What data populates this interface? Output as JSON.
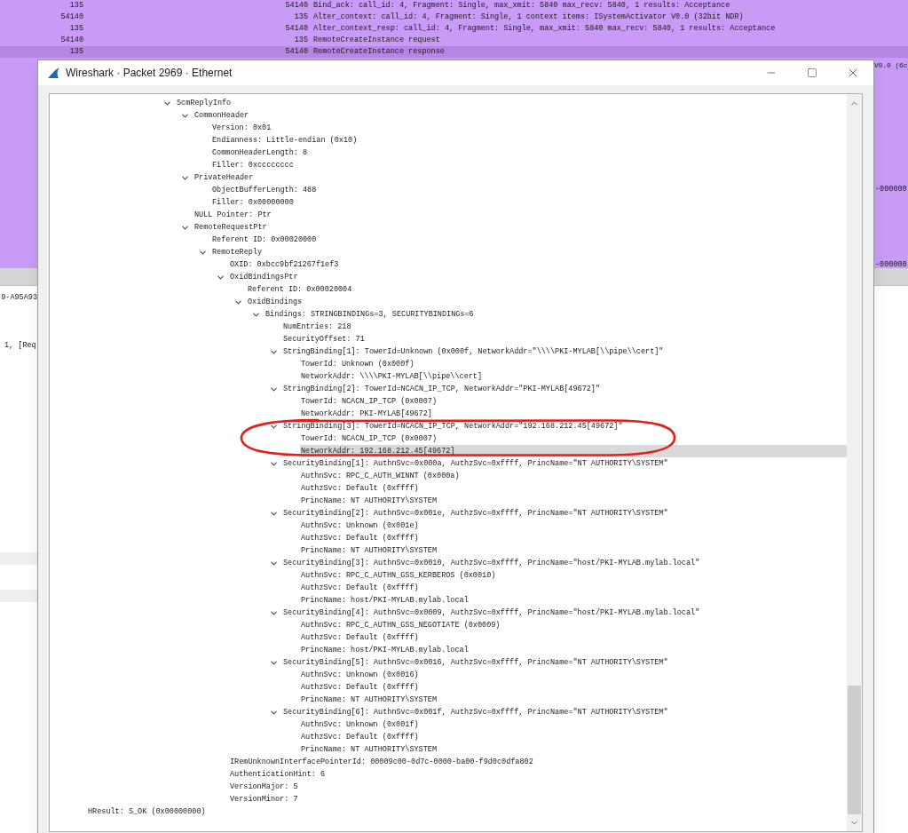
{
  "packet_list": {
    "rows": [
      {
        "source": "135",
        "destination": "54140",
        "info": "Bind_ack: call_id: 4, Fragment: Single, max_xmit: 5840 max_recv: 5840, 1 results: Acceptance",
        "selected": false
      },
      {
        "source": "54140",
        "destination": "135",
        "info": "Alter_context: call_id: 4, Fragment: Single, 1 context items: ISystemActivator V0.0 (32bit NDR)",
        "selected": false
      },
      {
        "source": "135",
        "destination": "54140",
        "info": "Alter_context_resp: call_id: 4, Fragment: Single, max_xmit: 5840 max_recv: 5840, 1 results: Acceptance",
        "selected": false
      },
      {
        "source": "54140",
        "destination": "135",
        "info": "RemoteCreateInstance request",
        "selected": false
      },
      {
        "source": "135",
        "destination": "54140",
        "info": "RemoteCreateInstance response",
        "selected": true
      }
    ],
    "partial_text": [
      "V0.0 (6c",
      "-000000",
      "-000000"
    ]
  },
  "packet_details": {
    "partial_text": [
      "9-A95A93",
      "1, [Req"
    ]
  },
  "dialog": {
    "title": "Wireshark · Packet 2969 · Ethernet",
    "tree": [
      {
        "label": "ScmReplyInfo",
        "expanded": true,
        "selected": false,
        "children": [
          {
            "label": "CommonHeader",
            "expanded": true,
            "selected": false,
            "children": [
              {
                "label": "Version: 0x01",
                "selected": false
              },
              {
                "label": "Endianness: Little-endian (0x10)",
                "selected": false
              },
              {
                "label": "CommonHeaderLength: 8",
                "selected": false
              },
              {
                "label": "Filler: 0xcccccccc",
                "selected": false
              }
            ]
          },
          {
            "label": "PrivateHeader",
            "expanded": true,
            "selected": false,
            "children": [
              {
                "label": "ObjectBufferLength: 488",
                "selected": false
              },
              {
                "label": "Filler: 0x00000000",
                "selected": false
              }
            ]
          },
          {
            "label": "NULL Pointer: Ptr",
            "selected": false
          },
          {
            "label": "RemoteRequestPtr",
            "expanded": true,
            "selected": false,
            "children": [
              {
                "label": "Referent ID: 0x00020000",
                "selected": false
              },
              {
                "label": "RemoteReply",
                "expanded": true,
                "selected": false,
                "children": [
                  {
                    "label": "OXID: 0xbcc9bf21267f1ef3",
                    "selected": false
                  },
                  {
                    "label": "OxidBindingsPtr",
                    "expanded": true,
                    "selected": false,
                    "children": [
                      {
                        "label": "Referent ID: 0x00020004",
                        "selected": false
                      },
                      {
                        "label": "OxidBindings",
                        "expanded": true,
                        "selected": false,
                        "children": [
                          {
                            "label": "Bindings: STRINGBINDINGs=3, SECURITYBINDINGs=6",
                            "expanded": true,
                            "selected": false,
                            "children": [
                              {
                                "label": "NumEntries: 218",
                                "selected": false
                              },
                              {
                                "label": "SecurityOffset: 71",
                                "selected": false
                              },
                              {
                                "label": "StringBinding[1]: TowerId=Unknown (0x000f, NetworkAddr=\"\\\\\\\\PKI-MYLAB[\\\\pipe\\\\cert]\"",
                                "expanded": true,
                                "selected": false,
                                "children": [
                                  {
                                    "label": "TowerId: Unknown (0x000f)",
                                    "selected": false
                                  },
                                  {
                                    "label": "NetworkAddr: \\\\\\\\PKI-MYLAB[\\\\pipe\\\\cert]",
                                    "selected": false
                                  }
                                ]
                              },
                              {
                                "label": "StringBinding[2]: TowerId=NCACN_IP_TCP, NetworkAddr=\"PKI-MYLAB[49672]\"",
                                "expanded": true,
                                "selected": false,
                                "children": [
                                  {
                                    "label": "TowerId: NCACN_IP_TCP (0x0007)",
                                    "selected": false
                                  },
                                  {
                                    "label": "NetworkAddr: PKI-MYLAB[49672]",
                                    "selected": false
                                  }
                                ]
                              },
                              {
                                "label": "StringBinding[3]: TowerId=NCACN_IP_TCP, NetworkAddr=\"192.168.212.45[49672]\"",
                                "expanded": true,
                                "selected": false,
                                "children": [
                                  {
                                    "label": "TowerId: NCACN_IP_TCP (0x0007)",
                                    "selected": false
                                  },
                                  {
                                    "label": "NetworkAddr: 192.168.212.45[49672]",
                                    "selected": true
                                  }
                                ]
                              },
                              {
                                "label": "SecurityBinding[1]: AuthnSvc=0x000a, AuthzSvc=0xffff, PrincName=\"NT AUTHORITY\\SYSTEM\"",
                                "expanded": true,
                                "selected": false,
                                "children": [
                                  {
                                    "label": "AuthnSvc: RPC_C_AUTH_WINNT (0x000a)",
                                    "selected": false
                                  },
                                  {
                                    "label": "AuthzSvc: Default (0xffff)",
                                    "selected": false
                                  },
                                  {
                                    "label": "PrincName: NT AUTHORITY\\SYSTEM",
                                    "selected": false
                                  }
                                ]
                              },
                              {
                                "label": "SecurityBinding[2]: AuthnSvc=0x001e, AuthzSvc=0xffff, PrincName=\"NT AUTHORITY\\SYSTEM\"",
                                "expanded": true,
                                "selected": false,
                                "children": [
                                  {
                                    "label": "AuthnSvc: Unknown (0x001e)",
                                    "selected": false
                                  },
                                  {
                                    "label": "AuthzSvc: Default (0xffff)",
                                    "selected": false
                                  },
                                  {
                                    "label": "PrincName: NT AUTHORITY\\SYSTEM",
                                    "selected": false
                                  }
                                ]
                              },
                              {
                                "label": "SecurityBinding[3]: AuthnSvc=0x0010, AuthzSvc=0xffff, PrincName=\"host/PKI-MYLAB.mylab.local\"",
                                "expanded": true,
                                "selected": false,
                                "children": [
                                  {
                                    "label": "AuthnSvc: RPC_C_AUTHN_GSS_KERBEROS (0x0010)",
                                    "selected": false
                                  },
                                  {
                                    "label": "AuthzSvc: Default (0xffff)",
                                    "selected": false
                                  },
                                  {
                                    "label": "PrincName: host/PKI-MYLAB.mylab.local",
                                    "selected": false
                                  }
                                ]
                              },
                              {
                                "label": "SecurityBinding[4]: AuthnSvc=0x0009, AuthzSvc=0xffff, PrincName=\"host/PKI-MYLAB.mylab.local\"",
                                "expanded": true,
                                "selected": false,
                                "children": [
                                  {
                                    "label": "AuthnSvc: RPC_C_AUTHN_GSS_NEGOTIATE (0x0009)",
                                    "selected": false
                                  },
                                  {
                                    "label": "AuthzSvc: Default (0xffff)",
                                    "selected": false
                                  },
                                  {
                                    "label": "PrincName: host/PKI-MYLAB.mylab.local",
                                    "selected": false
                                  }
                                ]
                              },
                              {
                                "label": "SecurityBinding[5]: AuthnSvc=0x0016, AuthzSvc=0xffff, PrincName=\"NT AUTHORITY\\SYSTEM\"",
                                "expanded": true,
                                "selected": false,
                                "children": [
                                  {
                                    "label": "AuthnSvc: Unknown (0x0016)",
                                    "selected": false
                                  },
                                  {
                                    "label": "AuthzSvc: Default (0xffff)",
                                    "selected": false
                                  },
                                  {
                                    "label": "PrincName: NT AUTHORITY\\SYSTEM",
                                    "selected": false
                                  }
                                ]
                              },
                              {
                                "label": "SecurityBinding[6]: AuthnSvc=0x001f, AuthzSvc=0xffff, PrincName=\"NT AUTHORITY\\SYSTEM\"",
                                "expanded": true,
                                "selected": false,
                                "children": [
                                  {
                                    "label": "AuthnSvc: Unknown (0x001f)",
                                    "selected": false
                                  },
                                  {
                                    "label": "AuthzSvc: Default (0xffff)",
                                    "selected": false
                                  },
                                  {
                                    "label": "PrincName: NT AUTHORITY\\SYSTEM",
                                    "selected": false
                                  }
                                ]
                              }
                            ]
                          }
                        ]
                      }
                    ]
                  },
                  {
                    "label": "IRemUnknownInterfacePointerId: 00009c00-0d7c-0000-ba00-f9d0c0dfa802",
                    "selected": false
                  },
                  {
                    "label": "AuthenticationHint: 6",
                    "selected": false
                  },
                  {
                    "label": "VersionMajor: 5",
                    "selected": false
                  },
                  {
                    "label": "VersionMinor: 7",
                    "selected": false
                  }
                ]
              }
            ]
          }
        ]
      },
      {
        "label": "HResult: S_OK (0x00000000)",
        "selected": false
      }
    ]
  }
}
